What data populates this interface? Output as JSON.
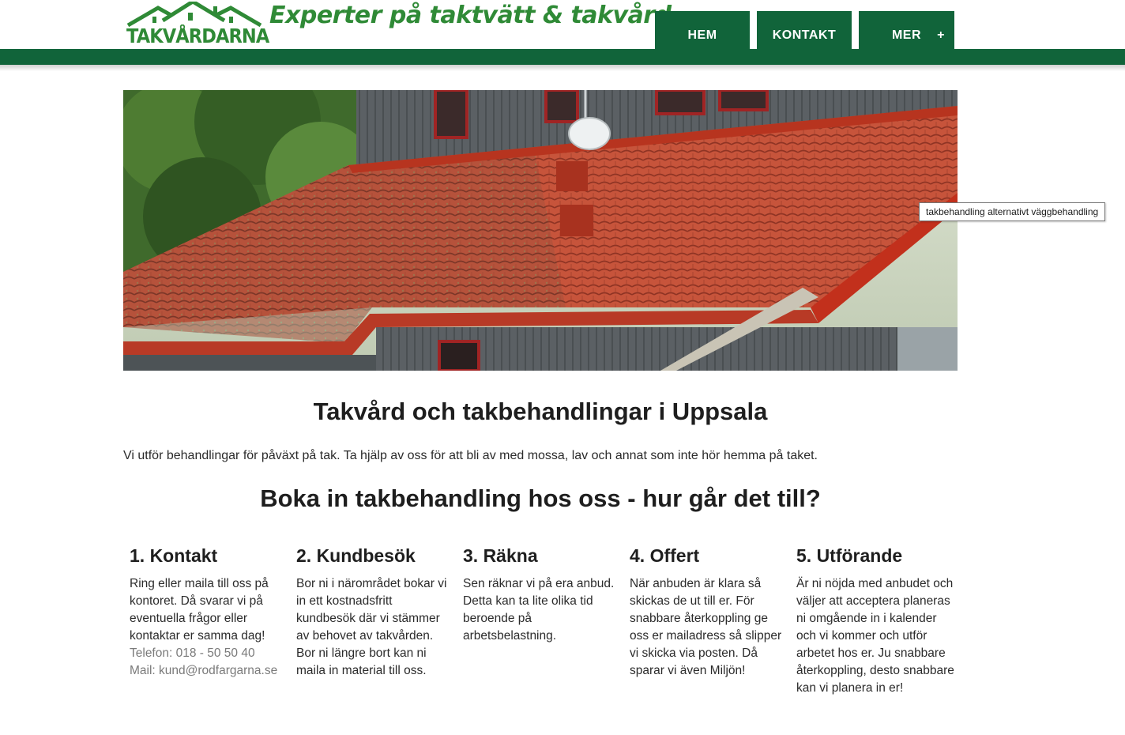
{
  "header": {
    "logo_text": "TAKVÅRDARNA",
    "tagline": "Experter på taktvätt & takvård",
    "nav": [
      {
        "label": "HEM"
      },
      {
        "label": "KONTAKT"
      },
      {
        "label": "MER",
        "suffix": "+"
      }
    ],
    "colors": {
      "brand_green": "#11643a",
      "logo_green": "#2f8a36"
    }
  },
  "hero": {
    "image_icon": "roof-photo",
    "tooltip": "takbehandling alternativt väggbehandling"
  },
  "main": {
    "title": "Takvård och takbehandlingar i Uppsala",
    "intro": "Vi utför behandlingar för påväxt på tak. Ta hjälp av oss för att bli av med mossa, lav och annat som inte hör hemma på taket.",
    "subtitle": "Boka in takbehandling hos oss - hur går det till?",
    "steps": [
      {
        "title": "1. Kontakt",
        "text": "Ring eller maila till oss på kontoret. Då svarar vi på eventuella frågor eller kontaktar er samma dag!",
        "phone": "Telefon: 018 - 50 50 40",
        "mail": "Mail: kund@rodfargarna.se"
      },
      {
        "title": "2. Kundbesök",
        "text": "Bor ni i närområdet bokar vi in ett kostnadsfritt kundbesök där vi stämmer av behovet av takvården. Bor ni längre bort kan ni maila in material till oss."
      },
      {
        "title": "3. Räkna",
        "text": "Sen räknar vi på era anbud. Detta kan ta lite olika tid beroende på arbetsbelastning."
      },
      {
        "title": "4. Offert",
        "text": "När anbuden är klara så skickas de ut till er. För snabbare återkoppling ge oss er mailadress så slipper vi skicka via posten. Då sparar vi även Miljön!"
      },
      {
        "title": "5. Utförande",
        "text": "Är ni nöjda med anbudet och väljer att acceptera planeras ni omgående in i kalender och vi kommer och utför arbetet hos er. Ju snabbare återkoppling, desto snabbare kan vi planera in er!"
      }
    ]
  }
}
